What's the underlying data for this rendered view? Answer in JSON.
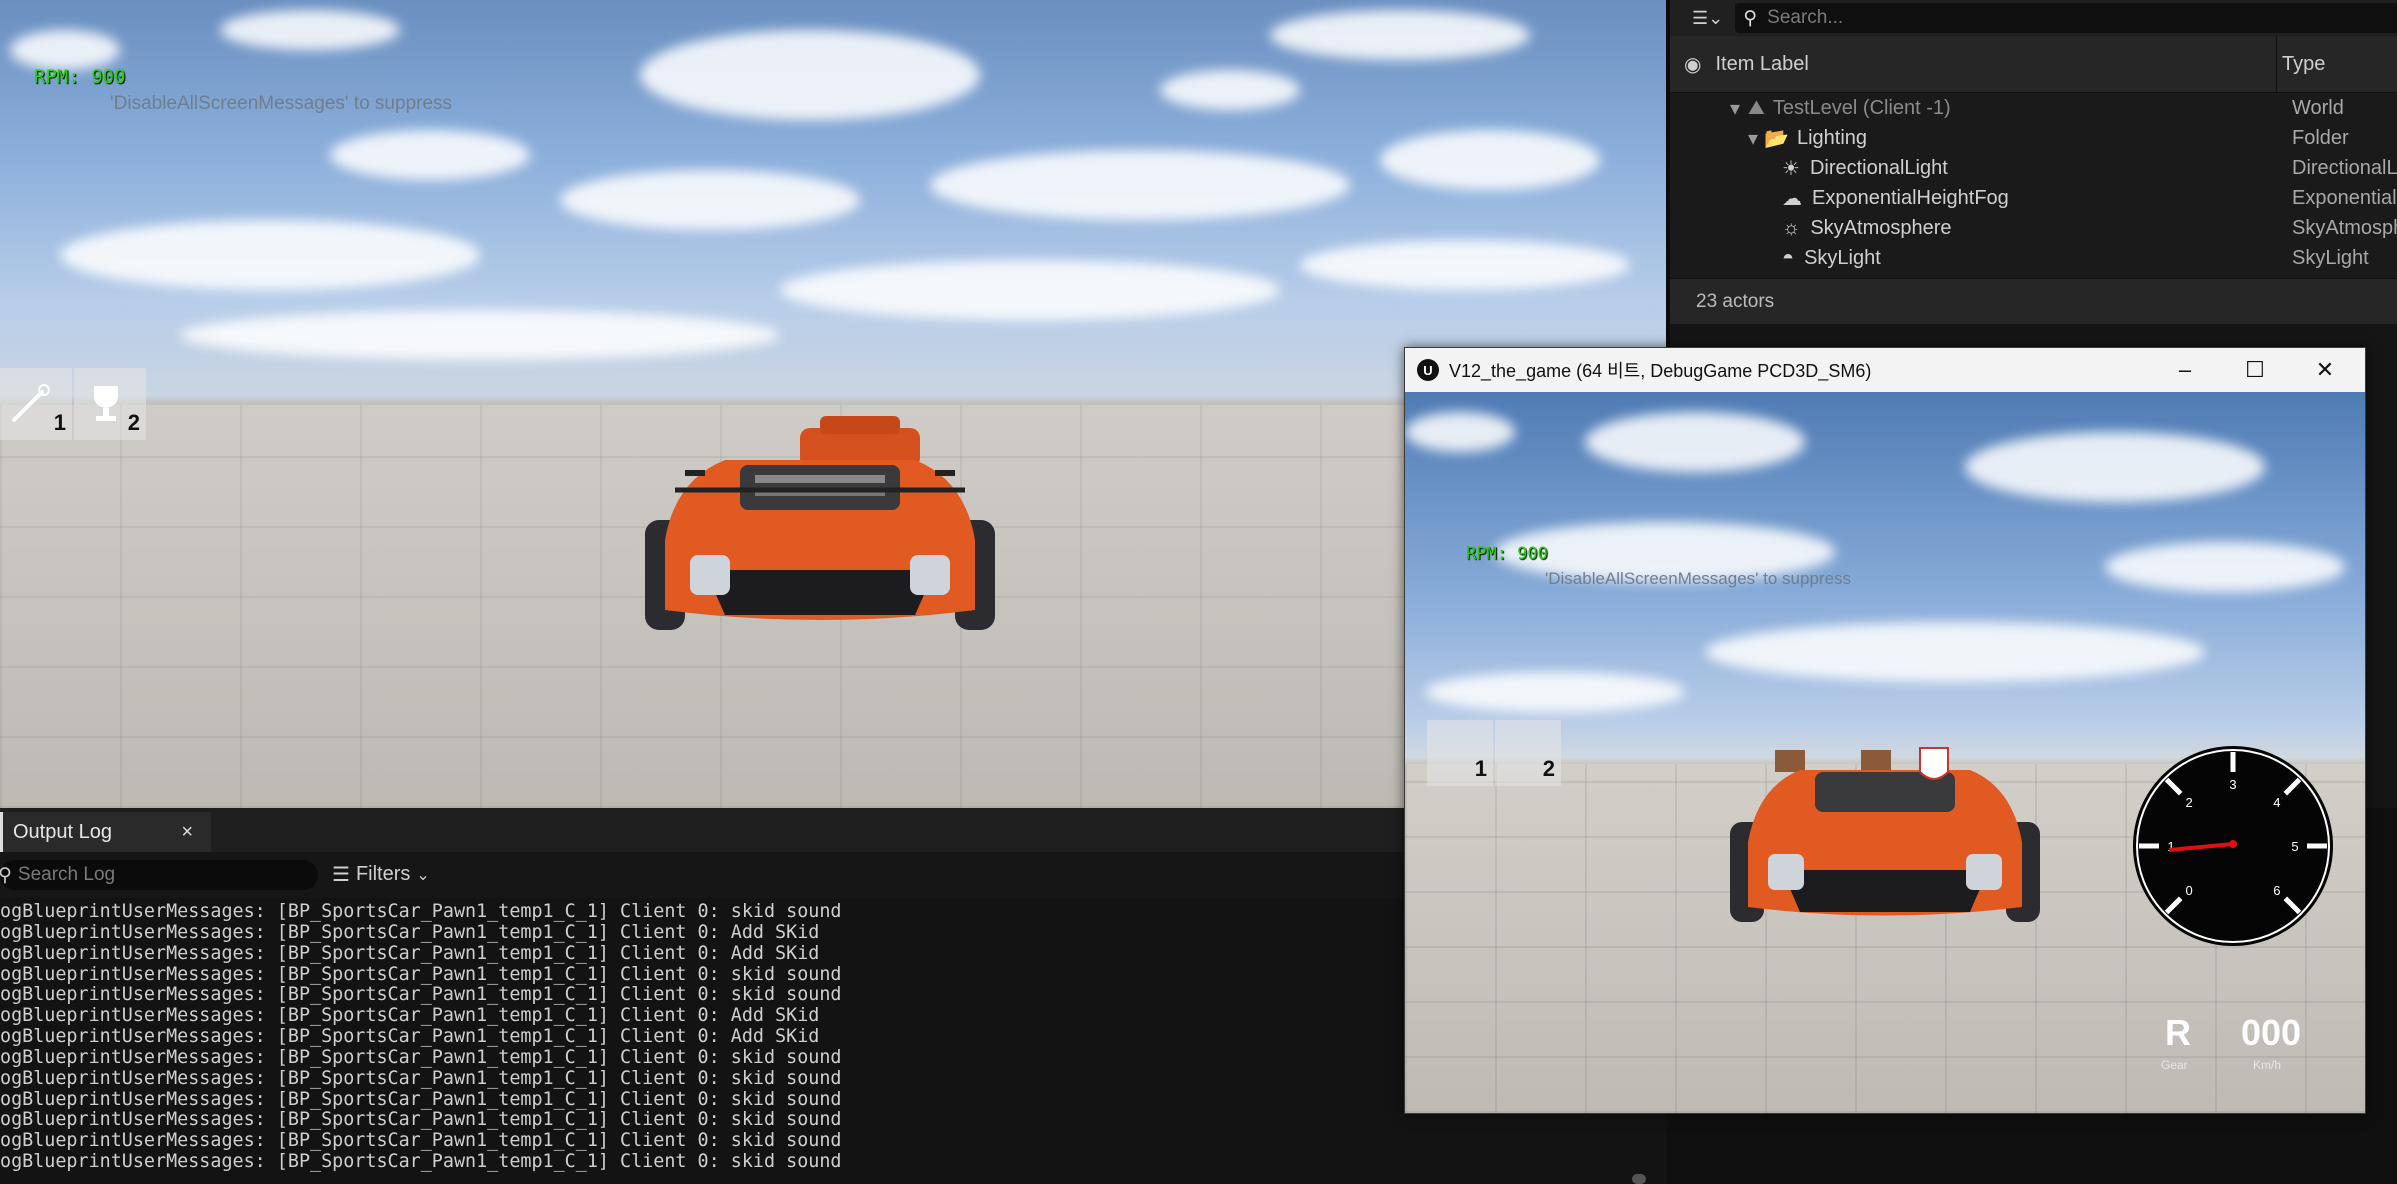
{
  "viewport": {
    "rpm_text": "RPM: 900",
    "suppress_msg": "'DisableAllScreenMessages' to suppress",
    "slots": [
      {
        "icon": "wand-icon",
        "number": "1"
      },
      {
        "icon": "trophy-icon",
        "number": "2"
      }
    ]
  },
  "outliner": {
    "search_placeholder": "Search...",
    "col_label": "Item Label",
    "col_type": "Type",
    "rows": [
      {
        "label": "TestLevel (Client -1)",
        "type": "World",
        "icon": "level-icon"
      },
      {
        "label": "Lighting",
        "type": "Folder",
        "icon": "folder-icon"
      },
      {
        "label": "DirectionalLight",
        "type": "DirectionalL",
        "icon": "sun-icon"
      },
      {
        "label": "ExponentialHeightFog",
        "type": "Exponentiall",
        "icon": "fog-icon"
      },
      {
        "label": "SkyAtmosphere",
        "type": "SkyAtmosph",
        "icon": "atmosphere-icon"
      },
      {
        "label": "SkyLight",
        "type": "SkyLight",
        "icon": "skylight-icon"
      }
    ],
    "actor_count": "23 actors"
  },
  "output_log": {
    "tab_label": "Output Log",
    "search_placeholder": "Search Log",
    "filters_label": "Filters",
    "lines": [
      "ogBlueprintUserMessages: [BP_SportsCar_Pawn1_temp1_C_1] Client 0: skid sound",
      "ogBlueprintUserMessages: [BP_SportsCar_Pawn1_temp1_C_1] Client 0: Add SKid",
      "ogBlueprintUserMessages: [BP_SportsCar_Pawn1_temp1_C_1] Client 0: Add SKid",
      "ogBlueprintUserMessages: [BP_SportsCar_Pawn1_temp1_C_1] Client 0: skid sound",
      "ogBlueprintUserMessages: [BP_SportsCar_Pawn1_temp1_C_1] Client 0: skid sound",
      "ogBlueprintUserMessages: [BP_SportsCar_Pawn1_temp1_C_1] Client 0: Add SKid",
      "ogBlueprintUserMessages: [BP_SportsCar_Pawn1_temp1_C_1] Client 0: Add SKid",
      "ogBlueprintUserMessages: [BP_SportsCar_Pawn1_temp1_C_1] Client 0: skid sound",
      "ogBlueprintUserMessages: [BP_SportsCar_Pawn1_temp1_C_1] Client 0: skid sound",
      "ogBlueprintUserMessages: [BP_SportsCar_Pawn1_temp1_C_1] Client 0: skid sound",
      "ogBlueprintUserMessages: [BP_SportsCar_Pawn1_temp1_C_1] Client 0: skid sound",
      "ogBlueprintUserMessages: [BP_SportsCar_Pawn1_temp1_C_1] Client 0: skid sound",
      "ogBlueprintUserMessages: [BP_SportsCar_Pawn1_temp1_C_1] Client 0: skid sound"
    ]
  },
  "game_window": {
    "title": "V12_the_game (64 비트, DebugGame PCD3D_SM6)",
    "rpm_text": "RPM: 900",
    "suppress_msg": "'DisableAllScreenMessages' to suppress",
    "slots": [
      "1",
      "2"
    ],
    "gauge_labels": [
      "0",
      "1",
      "2",
      "3",
      "4",
      "5",
      "6"
    ],
    "gear": "R",
    "gear_label": "Gear",
    "speed": "000",
    "speed_label": "Km/h"
  }
}
